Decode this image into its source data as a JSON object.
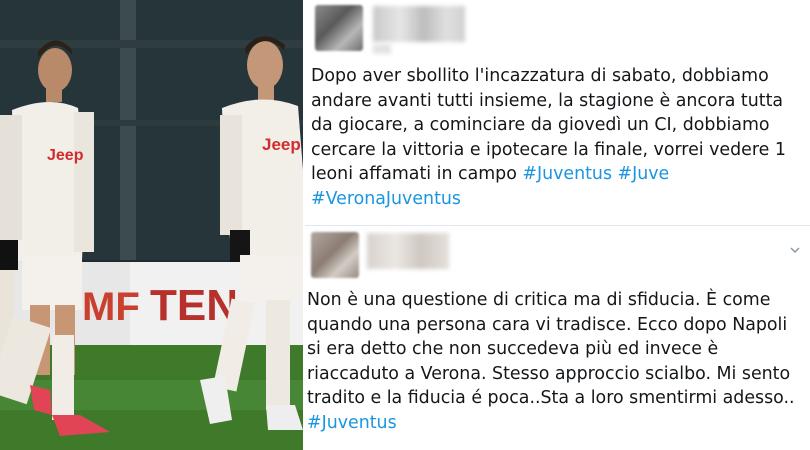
{
  "photo": {
    "description_hidden": "",
    "sponsor_board_left": "MF",
    "sponsor_board_right": "TEN",
    "shirt_sponsor": "Jeep"
  },
  "tweets": [
    {
      "author_blurred": true,
      "lines": [
        "Dopo aver sbollito l'incazzatura di sabato, dobbiamo",
        "andare avanti tutti insieme, la stagione è ancora tutta",
        "da giocare, a cominciare da giovedì un CI, dobbiamo",
        "cercare la vittoria e ipotecare la finale, vorrei vedere 1",
        "leoni affamati in campo "
      ],
      "hashtags_line5": [
        "#Juventus",
        "#Juve"
      ],
      "hashtags_line6": [
        "#VeronaJuventus"
      ]
    },
    {
      "author_blurred": true,
      "lines": [
        "Non è una questione di critica ma di sfiducia. È come",
        "quando una persona cara vi tradisce. Ecco dopo Napoli",
        "si era detto che non succedeva più ed invece è",
        "riaccaduto a Verona. Stesso approccio scialbo. Mi sento",
        "tradito e la fiducia é poca..Sta a loro smentirmi adesso.."
      ],
      "hashtags_line6": [
        "#Juventus"
      ]
    }
  ],
  "icons": {
    "menu": "chevron-down-icon"
  },
  "colors": {
    "hashtag": "#1b95e0",
    "text": "#14171a",
    "separator": "#e1e8ed"
  }
}
